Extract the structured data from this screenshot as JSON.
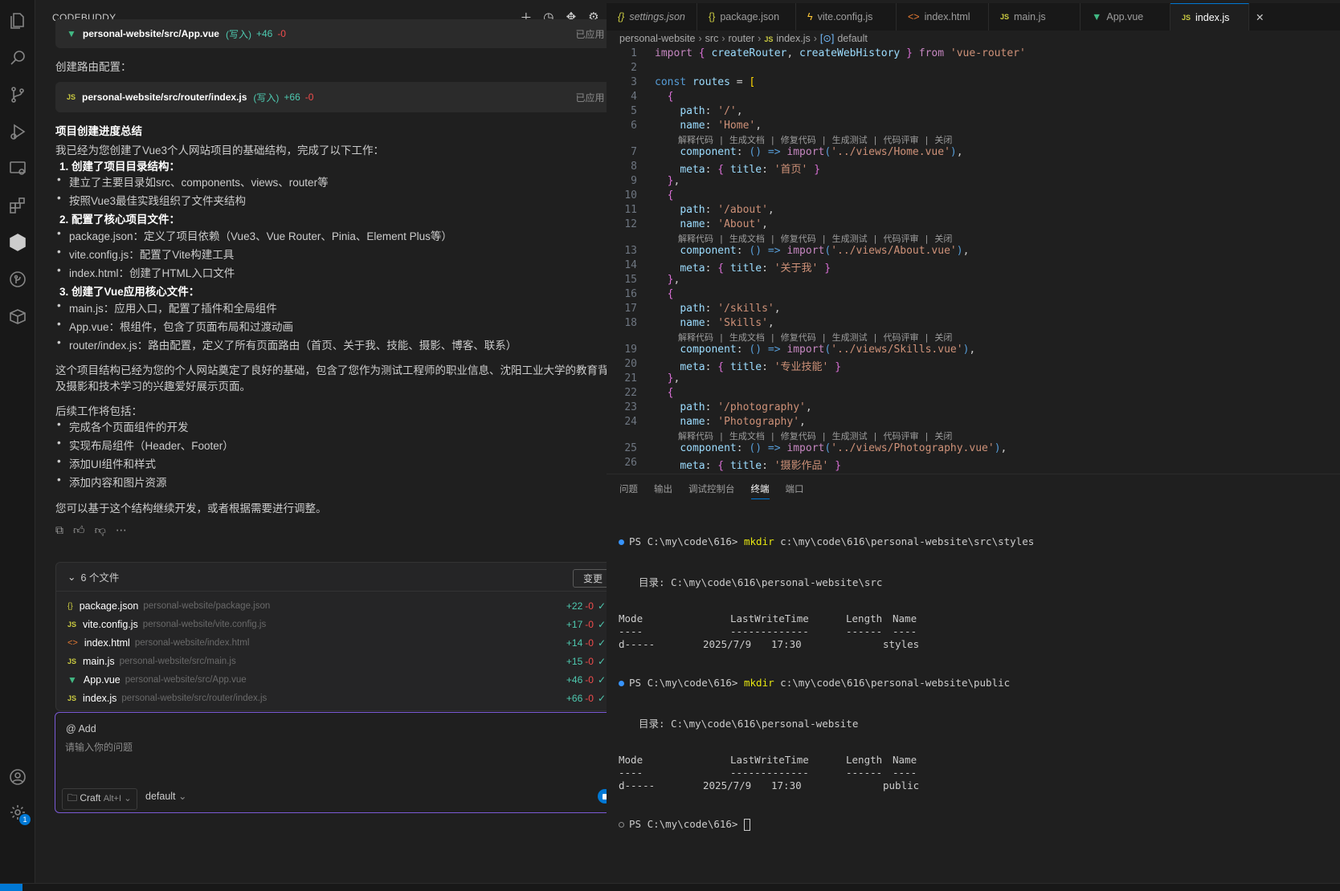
{
  "chat": {
    "title": "CODEBUDDY",
    "header_tools": [
      "plus-icon",
      "history-icon",
      "move-icon",
      "settings-icon",
      "more-icon"
    ],
    "cards": [
      {
        "icon": "vue-icon",
        "path": "personal-website/src/App.vue",
        "mode": "(写入)",
        "added": "+46",
        "removed": "-0",
        "status": "已应用",
        "status_dot": "•"
      },
      {
        "icon": "js-icon",
        "path": "personal-website/src/router/index.js",
        "mode": "(写入)",
        "added": "+66",
        "removed": "-0",
        "status": "已应用",
        "status_dot": "•"
      }
    ],
    "message": {
      "router_heading": "创建路由配置：",
      "summary_title": "项目创建进度总结",
      "intro": "我已经为您创建了Vue3个人网站项目的基础结构，完成了以下工作：",
      "sections": [
        {
          "title": "1. 创建了项目目录结构：",
          "items": [
            "建立了主要目录如src、components、views、router等",
            "按照Vue3最佳实践组织了文件夹结构"
          ]
        },
        {
          "title": "2. 配置了核心项目文件：",
          "items": [
            "package.json：定义了项目依赖（Vue3、Vue Router、Pinia、Element Plus等）",
            "vite.config.js：配置了Vite构建工具",
            "index.html：创建了HTML入口文件"
          ]
        },
        {
          "title": "3. 创建了Vue应用核心文件：",
          "items": [
            "main.js：应用入口，配置了插件和全局组件",
            "App.vue：根组件，包含了页面布局和过渡动画",
            "router/index.js：路由配置，定义了所有页面路由（首页、关于我、技能、摄影、博客、联系）"
          ]
        }
      ],
      "para1_line1": "这个项目结构已经为您的个人网站奠定了良好的基础，包含了您作为测试工程师的职业信息、沈阳工业大学的教育背景，以",
      "para1_line2": "及摄影和技术学习的兴趣爱好展示页面。",
      "followup_title": "后续工作将包括：",
      "followup": [
        "完成各个页面组件的开发",
        "实现布局组件（Header、Footer）",
        "添加UI组件和样式",
        "添加内容和图片资源"
      ],
      "closing": "您可以基于这个结构继续开发，或者根据需要进行调整。"
    },
    "actions": [
      "copy-icon",
      "thumbs-up-icon",
      "thumbs-down-icon",
      "more-icon"
    ],
    "changes": {
      "title": "6 个文件",
      "button": "变更",
      "files": [
        {
          "icon": "json-icon",
          "name": "package.json",
          "path": "personal-website/package.json",
          "added": "+22",
          "removed": "-0"
        },
        {
          "icon": "js-icon",
          "name": "vite.config.js",
          "path": "personal-website/vite.config.js",
          "added": "+17",
          "removed": "-0"
        },
        {
          "icon": "html-icon",
          "name": "index.html",
          "path": "personal-website/index.html",
          "added": "+14",
          "removed": "-0"
        },
        {
          "icon": "js-icon",
          "name": "main.js",
          "path": "personal-website/src/main.js",
          "added": "+15",
          "removed": "-0"
        },
        {
          "icon": "vue-icon",
          "name": "App.vue",
          "path": "personal-website/src/App.vue",
          "added": "+46",
          "removed": "-0"
        },
        {
          "icon": "js-icon",
          "name": "index.js",
          "path": "personal-website/src/router/index.js",
          "added": "+66",
          "removed": "-0"
        }
      ]
    },
    "input": {
      "add_label": "@ Add",
      "placeholder": "请输入你的问题",
      "mode_label": "Craft",
      "mode_shortcut": "Alt+I",
      "model_label": "default"
    }
  },
  "editor": {
    "tabs": [
      {
        "icon": "{ }",
        "label": "settings.json",
        "italic": true
      },
      {
        "icon": "{ }",
        "label": "package.json"
      },
      {
        "icon": "⚡",
        "label": "vite.config.js"
      },
      {
        "icon": "<>",
        "label": "index.html"
      },
      {
        "icon": "JS",
        "label": "main.js"
      },
      {
        "icon": "▼",
        "label": "App.vue"
      },
      {
        "icon": "JS",
        "label": "index.js",
        "active": true
      }
    ],
    "breadcrumb": [
      "personal-website",
      "src",
      "router",
      "index.js",
      "default"
    ],
    "codelens": "解释代码 | 生成文档 | 修复代码 | 生成测试 | 代码评审 | 关闭",
    "lines": [
      {
        "n": "1",
        "t": "import { createRouter, createWebHistory } from 'vue-router'"
      },
      {
        "n": "2",
        "t": ""
      },
      {
        "n": "3",
        "t": "const routes = ["
      },
      {
        "n": "4",
        "t": "  {"
      },
      {
        "n": "5",
        "t": "    path: '/',"
      },
      {
        "n": "6",
        "t": "    name: 'Home',",
        "lens": true
      },
      {
        "n": "7",
        "t": "    component: () => import('../views/Home.vue'),"
      },
      {
        "n": "8",
        "t": "    meta: { title: '首页' }"
      },
      {
        "n": "9",
        "t": "  },"
      },
      {
        "n": "10",
        "t": "  {"
      },
      {
        "n": "11",
        "t": "    path: '/about',"
      },
      {
        "n": "12",
        "t": "    name: 'About',",
        "lens": true
      },
      {
        "n": "13",
        "t": "    component: () => import('../views/About.vue'),"
      },
      {
        "n": "14",
        "t": "    meta: { title: '关于我' }"
      },
      {
        "n": "15",
        "t": "  },"
      },
      {
        "n": "16",
        "t": "  {"
      },
      {
        "n": "17",
        "t": "    path: '/skills',"
      },
      {
        "n": "18",
        "t": "    name: 'Skills',",
        "lens": true
      },
      {
        "n": "19",
        "t": "    component: () => import('../views/Skills.vue'),"
      },
      {
        "n": "20",
        "t": "    meta: { title: '专业技能' }"
      },
      {
        "n": "21",
        "t": "  },"
      },
      {
        "n": "22",
        "t": "  {"
      },
      {
        "n": "23",
        "t": "    path: '/photography',"
      },
      {
        "n": "24",
        "t": "    name: 'Photography',",
        "lens": true
      },
      {
        "n": "25",
        "t": "    component: () => import('../views/Photography.vue'),"
      },
      {
        "n": "26",
        "t": "    meta: { title: '摄影作品' }"
      }
    ]
  },
  "panel": {
    "tabs": [
      "问题",
      "输出",
      "调试控制台",
      "终端",
      "端口"
    ],
    "active_tab": "终端",
    "terminal": {
      "prompt": "PS C:\\my\\code\\616>",
      "cmd1": "mkdir",
      "arg1": "c:\\my\\code\\616\\personal-website\\src\\styles",
      "dir1": "目录: C:\\my\\code\\616\\personal-website\\src",
      "cmd2": "mkdir",
      "arg2": "c:\\my\\code\\616\\personal-website\\public",
      "dir2": "目录: C:\\my\\code\\616\\personal-website",
      "col_mode": "Mode",
      "col_time": "LastWriteTime",
      "col_len": "Length",
      "col_name": "Name",
      "dash_mode": "----",
      "dash_time": "-------------",
      "dash_len": "------",
      "dash_name": "----",
      "row1_mode": "d-----",
      "row1_date": "2025/7/9",
      "row1_time": "17:30",
      "row1_name": "styles",
      "row2_mode": "d-----",
      "row2_date": "2025/7/9",
      "row2_time": "17:30",
      "row2_name": "public"
    }
  },
  "activity_bar": {
    "items": [
      "explorer-icon",
      "search-icon",
      "source-control-icon",
      "run-debug-icon",
      "remote-explorer-icon",
      "extensions-icon",
      "codebuddy-icon",
      "git-graph-icon",
      "package-icon"
    ],
    "bottom": [
      "account-icon",
      "manage-icon"
    ],
    "manage_badge": "1"
  },
  "colors": {
    "accent": "#0078d4",
    "added": "#4ec9b0",
    "removed": "#f14c4c",
    "input_border": "#7b5ad6"
  }
}
